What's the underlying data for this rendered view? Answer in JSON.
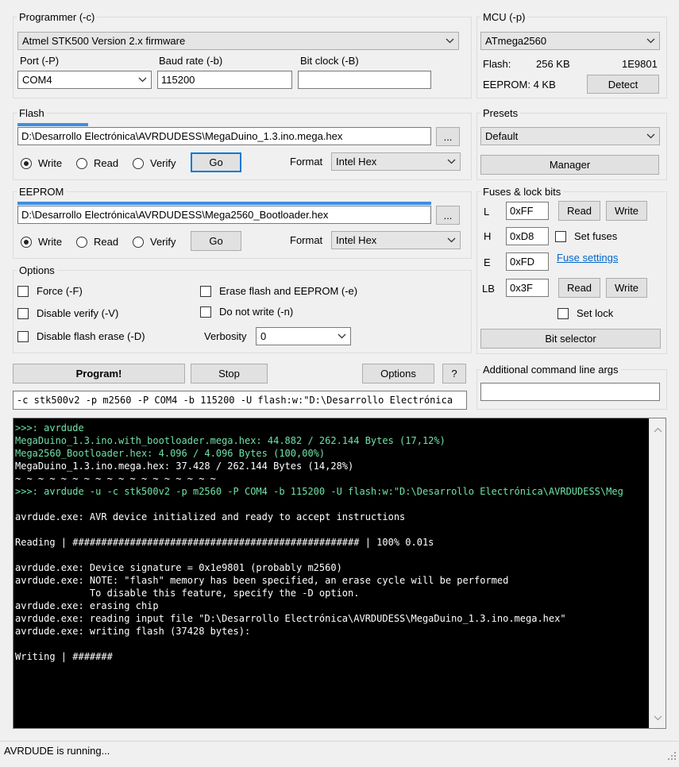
{
  "programmer": {
    "group_label": "Programmer (-c)",
    "selected": "Atmel STK500 Version 2.x firmware",
    "port_label": "Port (-P)",
    "port_value": "COM4",
    "baud_label": "Baud rate (-b)",
    "baud_value": "115200",
    "bitclock_label": "Bit clock (-B)",
    "bitclock_value": ""
  },
  "mcu": {
    "group_label": "MCU (-p)",
    "selected": "ATmega2560",
    "flash_label": "Flash:",
    "flash_size": "256 KB",
    "signature": "1E9801",
    "eeprom_label": "EEPROM: 4 KB",
    "detect_label": "Detect"
  },
  "flash": {
    "group_label": "Flash",
    "file": "D:\\Desarrollo Electrónica\\AVRDUDESS\\MegaDuino_1.3.ino.mega.hex",
    "browse": "...",
    "write": "Write",
    "read": "Read",
    "verify": "Verify",
    "go": "Go",
    "format_label": "Format",
    "format_value": "Intel Hex",
    "progress": 0.17
  },
  "eeprom": {
    "group_label": "EEPROM",
    "file": "D:\\Desarrollo Electrónica\\AVRDUDESS\\Mega2560_Bootloader.hex",
    "browse": "...",
    "write": "Write",
    "read": "Read",
    "verify": "Verify",
    "go": "Go",
    "format_label": "Format",
    "format_value": "Intel Hex",
    "progress": 1.0
  },
  "presets": {
    "group_label": "Presets",
    "selected": "Default",
    "manager_label": "Manager"
  },
  "fuses": {
    "group_label": "Fuses & lock bits",
    "l_label": "L",
    "l_value": "0xFF",
    "h_label": "H",
    "h_value": "0xD8",
    "e_label": "E",
    "e_value": "0xFD",
    "lb_label": "LB",
    "lb_value": "0x3F",
    "read_label": "Read",
    "write_label": "Write",
    "set_fuses_label": "Set fuses",
    "fuse_settings_link": "Fuse settings",
    "set_lock_label": "Set lock",
    "bit_selector_label": "Bit selector"
  },
  "options": {
    "group_label": "Options",
    "force": "Force (-F)",
    "disable_verify": "Disable verify (-V)",
    "disable_flash_erase": "Disable flash erase (-D)",
    "erase_flash_eeprom": "Erase flash and EEPROM (-e)",
    "do_not_write": "Do not write (-n)",
    "verbosity_label": "Verbosity",
    "verbosity_value": "0"
  },
  "actions": {
    "program": "Program!",
    "stop": "Stop",
    "options": "Options",
    "help": "?"
  },
  "additional_args": {
    "label": "Additional command line args",
    "value": ""
  },
  "command_line": "-c stk500v2 -p m2560 -P COM4 -b 115200 -U flash:w:\"D:\\Desarrollo Electrónica",
  "console": {
    "lines": [
      {
        "text": ">>>: avrdude",
        "color": "green"
      },
      {
        "text": "MegaDuino_1.3.ino.with_bootloader.mega.hex: 44.882 / 262.144 Bytes (17,12%)",
        "color": "green"
      },
      {
        "text": "Mega2560_Bootloader.hex: 4.096 / 4.096 Bytes (100,00%)",
        "color": "green"
      },
      {
        "text": "MegaDuino_1.3.ino.mega.hex: 37.428 / 262.144 Bytes (14,28%)",
        "color": "white"
      },
      {
        "text": "~ ~ ~ ~ ~ ~ ~ ~ ~ ~ ~ ~ ~ ~ ~ ~ ~ ~",
        "color": "white"
      },
      {
        "text": ">>>: avrdude -u -c stk500v2 -p m2560 -P COM4 -b 115200 -U flash:w:\"D:\\Desarrollo Electrónica\\AVRDUDESS\\Meg",
        "color": "green"
      },
      {
        "text": "",
        "color": "white"
      },
      {
        "text": "avrdude.exe: AVR device initialized and ready to accept instructions",
        "color": "white"
      },
      {
        "text": "",
        "color": "white"
      },
      {
        "text": "Reading | ################################################## | 100% 0.01s",
        "color": "white"
      },
      {
        "text": "",
        "color": "white"
      },
      {
        "text": "avrdude.exe: Device signature = 0x1e9801 (probably m2560)",
        "color": "white"
      },
      {
        "text": "avrdude.exe: NOTE: \"flash\" memory has been specified, an erase cycle will be performed",
        "color": "white"
      },
      {
        "text": "             To disable this feature, specify the -D option.",
        "color": "white"
      },
      {
        "text": "avrdude.exe: erasing chip",
        "color": "white"
      },
      {
        "text": "avrdude.exe: reading input file \"D:\\Desarrollo Electrónica\\AVRDUDESS\\MegaDuino_1.3.ino.mega.hex\"",
        "color": "white"
      },
      {
        "text": "avrdude.exe: writing flash (37428 bytes):",
        "color": "white"
      },
      {
        "text": "",
        "color": "white"
      },
      {
        "text": "Writing | #######",
        "color": "white"
      }
    ]
  },
  "status": "AVRDUDE is running...",
  "icons": {
    "dropdown": "chevron-down-icon",
    "scroll_up": "chevron-up-icon",
    "scroll_down": "chevron-down-icon",
    "grip": "resize-grip-icon"
  }
}
